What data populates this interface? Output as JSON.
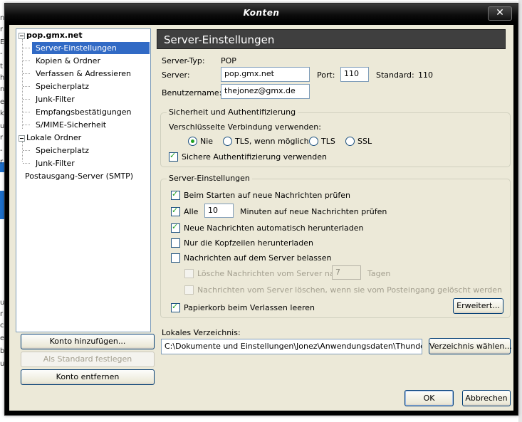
{
  "window": {
    "title": "Konten",
    "close_symbol": "✕"
  },
  "background": {
    "left_fragments": [
      "n",
      "r",
      "E",
      "-",
      "t",
      "h",
      "n",
      "e",
      "k",
      "u",
      "r",
      "-",
      "r",
      "u",
      "r",
      "c",
      "e",
      "bi",
      "u"
    ]
  },
  "tree": {
    "account": "pop.gmx.net",
    "account_items": [
      "Server-Einstellungen",
      "Kopien & Ordner",
      "Verfassen & Adressieren",
      "Speicherplatz",
      "Junk-Filter",
      "Empfangsbestätigungen",
      "S/MIME-Sicherheit"
    ],
    "local": "Lokale Ordner",
    "local_items": [
      "Speicherplatz",
      "Junk-Filter"
    ],
    "smtp": "Postausgang-Server (SMTP)"
  },
  "left_buttons": {
    "add": "Konto hinzufügen...",
    "default": "Als Standard festlegen",
    "remove": "Konto entfernen"
  },
  "panel": {
    "heading": "Server-Einstellungen",
    "server_type_label": "Server-Typ:",
    "server_type_value": "POP",
    "server_label": "Server:",
    "server_value": "pop.gmx.net",
    "port_label": "Port:",
    "port_value": "110",
    "standard_label": "Standard:",
    "standard_value": "110",
    "username_label": "Benutzername:",
    "username_value": "thejonez@gmx.de"
  },
  "security": {
    "title": "Sicherheit und Authentifizierung",
    "encryption_label": "Verschlüsselte Verbindung verwenden:",
    "options": [
      "Nie",
      "TLS, wenn möglich",
      "TLS",
      "SSL"
    ],
    "selected": "Nie",
    "secure_auth": "Sichere Authentifizierung verwenden",
    "secure_auth_checked": true
  },
  "server_settings": {
    "title": "Server-Einstellungen",
    "check_on_start": "Beim Starten auf neue Nachrichten prüfen",
    "check_every_prefix": "Alle",
    "check_every_value": "10",
    "check_every_suffix": "Minuten auf neue Nachrichten prüfen",
    "auto_download": "Neue Nachrichten automatisch herunterladen",
    "headers_only": "Nur die Kopfzeilen herunterladen",
    "leave_on_server": "Nachrichten auf dem Server belassen",
    "delete_after_prefix": "Lösche Nachrichten vom Server nach",
    "delete_after_value": "7",
    "delete_after_suffix": "Tagen",
    "delete_when_deleted": "Nachrichten vom Server löschen, wenn sie vom Posteingang gelöscht werden",
    "empty_trash": "Papierkorb beim Verlassen leeren",
    "advanced_button": "Erweitert..."
  },
  "local_dir": {
    "label": "Lokales Verzeichnis:",
    "path": "C:\\Dokumente und Einstellungen\\Jonez\\Anwendungsdaten\\Thunderbird\\Profiles",
    "choose_button": "Verzeichnis wählen..."
  },
  "footer": {
    "ok": "OK",
    "cancel": "Abbrechen"
  }
}
